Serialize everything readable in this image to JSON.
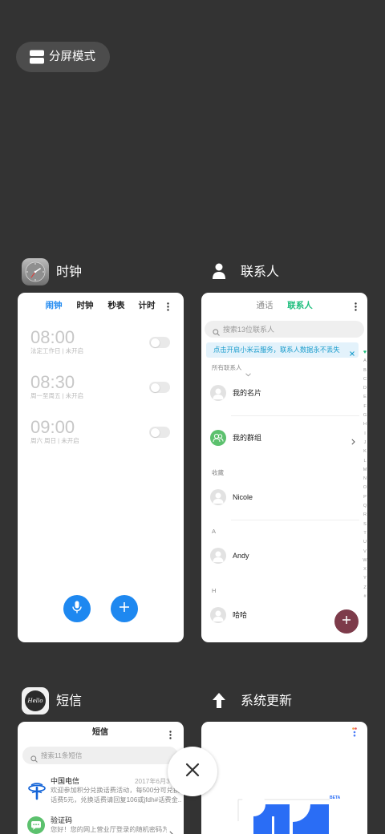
{
  "colors": {
    "background": "#333333",
    "accent_blue": "#1e88f0",
    "contacts_green": "#1bbd7b",
    "contacts_fab": "#7d3b4a",
    "group_avatar": "#5cc16e",
    "banner_bg": "#e3f2fb",
    "banner_text": "#1a9ccc",
    "update_blue": "#2a6df5"
  },
  "split_screen": {
    "label": "分屏模式",
    "icon": "split-screen-icon"
  },
  "close_all": {
    "icon": "close-icon"
  },
  "clock": {
    "app_name": "时钟",
    "icon": "clock-app-icon",
    "tabs": [
      "闹钟",
      "时钟",
      "秒表",
      "计时"
    ],
    "active_tab_index": 0,
    "alarms": [
      {
        "time": "08:00",
        "repeat": "法定工作日 | 未开启",
        "enabled": false
      },
      {
        "time": "08:30",
        "repeat": "周一至周五 | 未开启",
        "enabled": false
      },
      {
        "time": "09:00",
        "repeat": "周六 周日 | 未开启",
        "enabled": false
      }
    ],
    "voice_button_icon": "mic-icon",
    "add_button_icon": "plus-icon"
  },
  "contacts": {
    "app_name": "联系人",
    "icon": "person-icon",
    "tabs": [
      "通话",
      "联系人"
    ],
    "active_tab_index": 1,
    "search_placeholder": "搜索13位联系人",
    "banner": "点击开启小米云服务，联系人数据永不丢失",
    "filter_label": "所有联系人",
    "my_card": "我的名片",
    "my_groups": "我的群组",
    "favorites_header": "收藏",
    "favorites": [
      "Nicole"
    ],
    "groups": [
      {
        "letter": "A",
        "names": [
          "Andy"
        ]
      },
      {
        "letter": "H",
        "names": [
          "哈哈"
        ]
      }
    ],
    "index": [
      "♥",
      "A",
      "B",
      "C",
      "D",
      "E",
      "F",
      "G",
      "H",
      "I",
      "J",
      "K",
      "L",
      "M",
      "N",
      "O",
      "P",
      "Q",
      "R",
      "S",
      "T",
      "U",
      "V",
      "W",
      "X",
      "Y",
      "Z",
      "#"
    ]
  },
  "messages": {
    "app_name": "短信",
    "icon_label": "Hello",
    "title": "短信",
    "search_placeholder": "搜索11条短信",
    "threads": [
      {
        "sender": "中国电信",
        "icon": "china-telecom-logo-icon",
        "date": "2017年6月30",
        "preview_lines": [
          "欢迎参加积分兑换话费活动，每500分可兑换",
          "话费5元，兑换话费请回复106或jfdh#话费金..."
        ]
      },
      {
        "sender": "验证码",
        "icon": "verification-code-icon",
        "preview_lines": [
          "您好！您的网上营业厅登录的随机密码为："
        ]
      }
    ]
  },
  "system_update": {
    "app_name": "系统更新",
    "icon": "arrow-up-icon",
    "badge": "BETA"
  }
}
